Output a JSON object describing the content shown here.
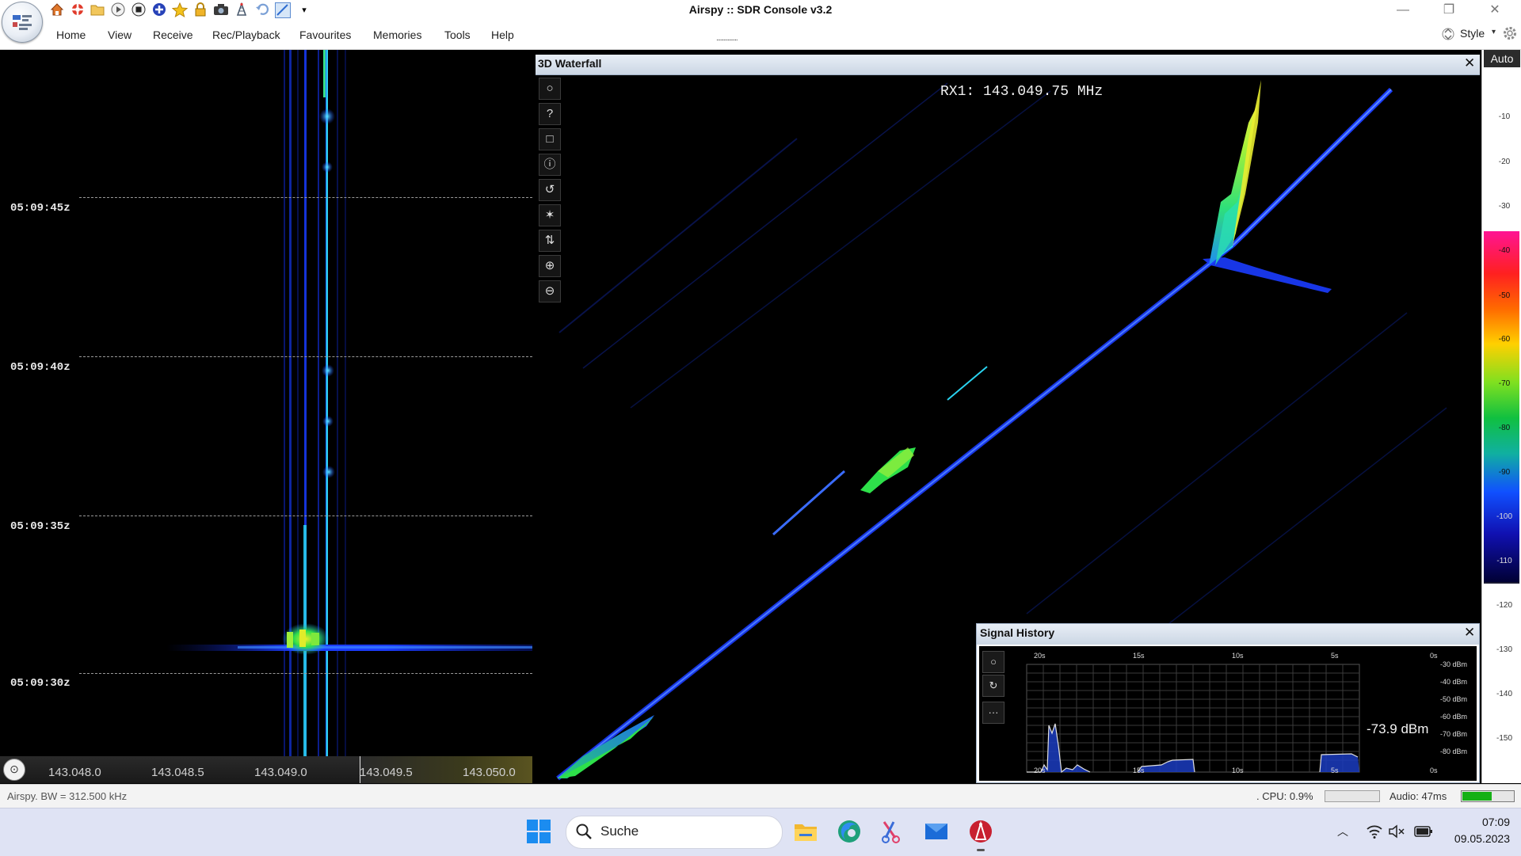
{
  "window": {
    "title": "Airspy :: SDR Console v3.2",
    "style_label": "Style"
  },
  "quick_access": {
    "icons": [
      "home-icon",
      "lifebuoy-icon",
      "folder-icon",
      "play-icon",
      "stop-icon",
      "add-icon",
      "favourite-star-icon",
      "lock-icon",
      "camera-icon",
      "tower-icon",
      "undo-icon",
      "chart-icon",
      "dropdown-arrow-icon"
    ]
  },
  "menu": {
    "items": [
      "Home",
      "View",
      "Receive",
      "Rec/Playback",
      "Favourites",
      "Memories",
      "Tools",
      "Help"
    ],
    "separator_dots": "..............."
  },
  "waterfall": {
    "time_markers": [
      "05:09:45z",
      "05:09:40z",
      "05:09:35z",
      "05:09:30z"
    ],
    "freq_ticks": [
      "143.048.0",
      "143.048.5",
      "143.049.0",
      "143.049.5",
      "143.050.0"
    ]
  },
  "waterfall3d": {
    "title": "3D Waterfall",
    "close_symbol": "✕",
    "rx_label": "RX1: 143.049.75 MHz",
    "toolbar": [
      {
        "name": "circle-icon",
        "glyph": "○"
      },
      {
        "name": "help-icon",
        "glyph": "?"
      },
      {
        "name": "square-icon",
        "glyph": "□"
      },
      {
        "name": "info-icon",
        "glyph": "ⓘ"
      },
      {
        "name": "rotate-icon",
        "glyph": "↺"
      },
      {
        "name": "star-icon",
        "glyph": "✶"
      },
      {
        "name": "up-down-arrows-icon",
        "glyph": "⇅"
      },
      {
        "name": "zoom-in-icon",
        "glyph": "⊕"
      },
      {
        "name": "zoom-out-icon",
        "glyph": "⊖"
      }
    ]
  },
  "signal_history": {
    "title": "Signal History",
    "close_symbol": "✕",
    "current_level": "-73.9 dBm",
    "time_ticks": [
      "20s",
      "15s",
      "10s",
      "5s",
      "0s"
    ],
    "dbm_ticks": [
      "-30 dBm",
      "-40 dBm",
      "-50 dBm",
      "-60 dBm",
      "-70 dBm",
      "-80 dBm"
    ],
    "buttons": [
      "○",
      "↻",
      "···"
    ]
  },
  "scale": {
    "auto_label": "Auto",
    "ticks": [
      "-10",
      "-20",
      "-30",
      "-40",
      "-50",
      "-60",
      "-70",
      "-80",
      "-90",
      "-100",
      "-110",
      "-120",
      "-130",
      "-140",
      "-150"
    ]
  },
  "status": {
    "left": "Airspy. BW = 312.500 kHz",
    "cpu": ". CPU: 0.9%",
    "audio": "Audio: 47ms",
    "audio_level": 0.58
  },
  "taskbar": {
    "search_label": "Suche",
    "apps": [
      "windows-start-icon",
      "file-explorer-icon",
      "edge-browser-icon",
      "snipping-tool-icon",
      "mail-icon",
      "sdr-console-icon"
    ],
    "clock_time": "07:09",
    "clock_date": "09.05.2023"
  },
  "colors": {
    "panel_header": "#cbd6e4",
    "trace_blue": "#1e40ff",
    "trace_cyan": "#1fd9e8",
    "trace_green": "#28e050",
    "trace_yellow": "#e8e830",
    "audio_meter": "#16b016"
  }
}
